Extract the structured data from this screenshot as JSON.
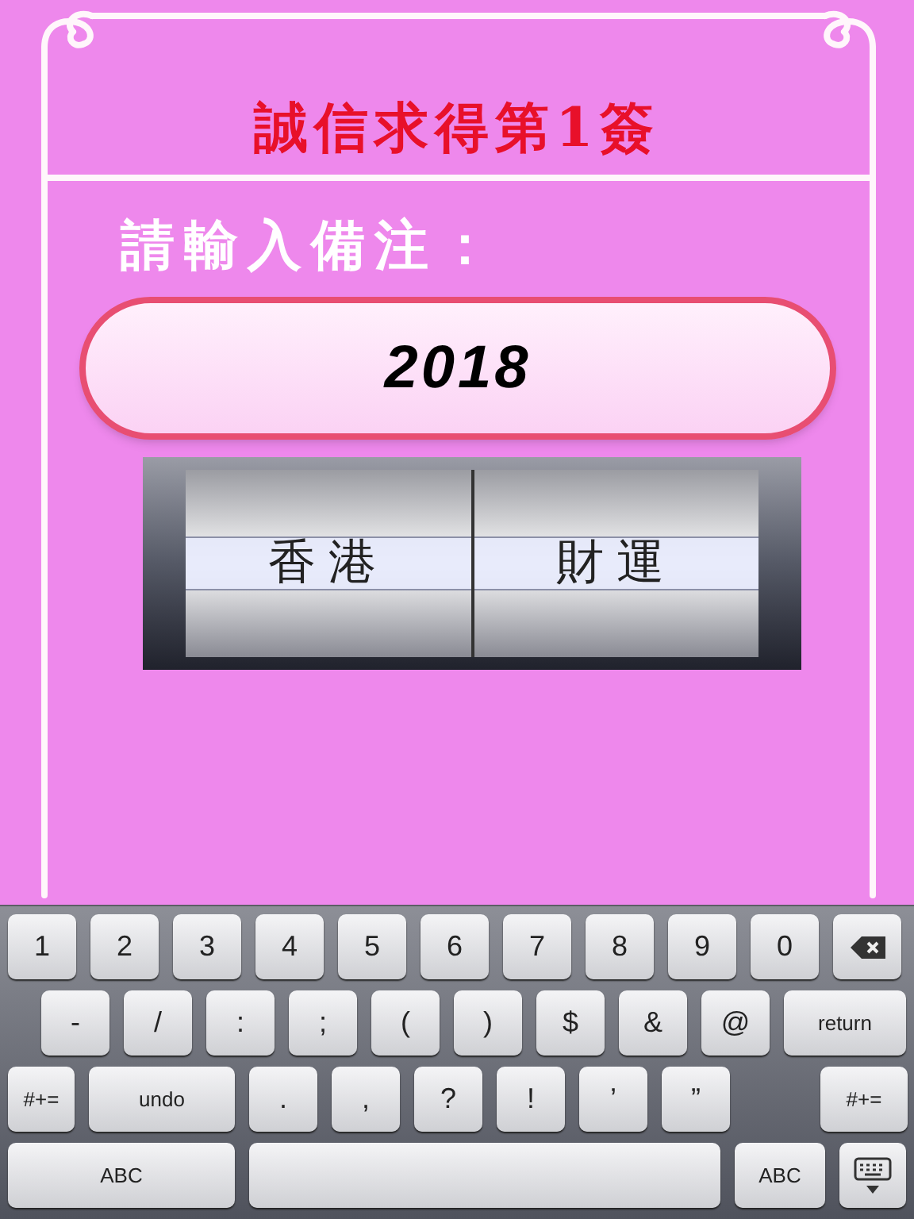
{
  "title": "誠信求得第1簽",
  "prompt": "請輸入備注：",
  "note_field": {
    "value": "2018"
  },
  "picker": {
    "columns": [
      {
        "selected_value": "香港"
      },
      {
        "selected_value": "財運"
      }
    ]
  },
  "keyboard": {
    "rows": [
      [
        {
          "kind": "char",
          "label": "1"
        },
        {
          "kind": "char",
          "label": "2"
        },
        {
          "kind": "char",
          "label": "3"
        },
        {
          "kind": "char",
          "label": "4"
        },
        {
          "kind": "char",
          "label": "5"
        },
        {
          "kind": "char",
          "label": "6"
        },
        {
          "kind": "char",
          "label": "7"
        },
        {
          "kind": "char",
          "label": "8"
        },
        {
          "kind": "char",
          "label": "9"
        },
        {
          "kind": "char",
          "label": "0"
        },
        {
          "kind": "delete"
        }
      ],
      [
        {
          "kind": "char",
          "label": "-"
        },
        {
          "kind": "char",
          "label": "/"
        },
        {
          "kind": "char",
          "label": ":"
        },
        {
          "kind": "char",
          "label": ";"
        },
        {
          "kind": "char",
          "label": "("
        },
        {
          "kind": "char",
          "label": ")"
        },
        {
          "kind": "char",
          "label": "$"
        },
        {
          "kind": "char",
          "label": "&"
        },
        {
          "kind": "char",
          "label": "@"
        },
        {
          "kind": "return",
          "label": "return"
        }
      ],
      [
        {
          "kind": "symbols",
          "label": "#+="
        },
        {
          "kind": "undo",
          "label": "undo"
        },
        {
          "kind": "char",
          "label": "."
        },
        {
          "kind": "char",
          "label": ","
        },
        {
          "kind": "char",
          "label": "?"
        },
        {
          "kind": "char",
          "label": "!"
        },
        {
          "kind": "char",
          "label": "’"
        },
        {
          "kind": "char",
          "label": "”"
        },
        {
          "kind": "symbols-right",
          "label": "#+="
        }
      ],
      [
        {
          "kind": "abc-wide",
          "label": "ABC"
        },
        {
          "kind": "space"
        },
        {
          "kind": "abc",
          "label": "ABC"
        },
        {
          "kind": "hide"
        }
      ]
    ]
  }
}
